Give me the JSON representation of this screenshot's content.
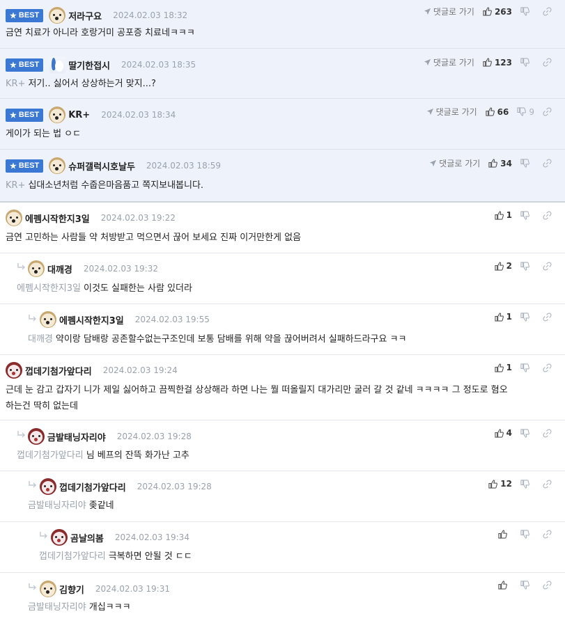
{
  "best_label": "BEST",
  "reply_label": "댓글로 가기",
  "comments": [
    {
      "id": "c1",
      "nickname": "저라구요",
      "date": "2024.02.03 18:32",
      "likes": "263",
      "dislikes": "",
      "target": "",
      "text": "금연 치료가 아니라 호랑거미 공포증 치료네ㅋㅋㅋ",
      "best": true,
      "avatar": "dog-icon"
    },
    {
      "id": "c2",
      "nickname": "딸기한접시",
      "date": "2024.02.03 18:35",
      "likes": "123",
      "dislikes": "",
      "target": "KR+",
      "text": "저기.. 싫어서 상상하는거 맞지...?",
      "best": true,
      "avatar": "bunny-icon"
    },
    {
      "id": "c3",
      "nickname": "KR+",
      "date": "2024.02.03 18:34",
      "likes": "66",
      "dislikes": "9",
      "target": "",
      "text": "게이가 되는 법 ㅇㄷ",
      "best": true,
      "avatar": "dog-icon"
    },
    {
      "id": "c4",
      "nickname": "슈퍼갤럭시호날두",
      "date": "2024.02.03 18:59",
      "likes": "34",
      "dislikes": "",
      "target": "KR+",
      "text": "십대소년처럼 수줍은마음품고 쪽지보내봅니다.",
      "best": true,
      "avatar": "dog-icon"
    },
    {
      "id": "c5",
      "nickname": "에펨시작한지3일",
      "date": "2024.02.03 19:22",
      "likes": "1",
      "dislikes": "",
      "target": "",
      "text": "금연 고민하는 사람들 약 처방받고 먹으면서 끊어 보세요 진짜 이거만한게 없음",
      "best": false,
      "avatar": "dog-icon"
    },
    {
      "id": "c6",
      "nickname": "대깨경",
      "date": "2024.02.03 19:32",
      "likes": "2",
      "dislikes": "",
      "target": "에펨시작한지3일",
      "text": "이것도 실패한는 사람 있더라",
      "best": false,
      "avatar": "dog-icon"
    },
    {
      "id": "c7",
      "nickname": "에펨시작한지3일",
      "date": "2024.02.03 19:55",
      "likes": "1",
      "dislikes": "",
      "target": "대깨경",
      "text": "약이랑 담배랑 공존할수없는구조인데 보통 담배를 위해 약을 끊어버려서 실패하드라구요 ㅋㅋ",
      "best": false,
      "avatar": "dog-icon"
    },
    {
      "id": "c8",
      "nickname": "껍데기첨가앞다리",
      "date": "2024.02.03 19:24",
      "likes": "1",
      "dislikes": "",
      "target": "",
      "text_line1": "근데 눈 감고 갑자기 니가 제일 싫어하고 끔찍한걸 상상해라 하면 나는 뭘 떠올릴지 대가리만 굴러 갈 것 같네 ㅋㅋㅋㅋ 그 정도로 혐오",
      "text_line2": "하는건 딱히 없는데",
      "best": false,
      "avatar": "red-icon"
    },
    {
      "id": "c9",
      "nickname": "금발태닝자리야",
      "date": "2024.02.03 19:28",
      "likes": "4",
      "dislikes": "",
      "target": "껍데기첨가앞다리",
      "text": "님 베프의 잔뜩 화가난 고추",
      "best": false,
      "avatar": "red-icon"
    },
    {
      "id": "c10",
      "nickname": "껍데기첨가앞다리",
      "date": "2024.02.03 19:28",
      "likes": "12",
      "dislikes": "",
      "target": "금발태닝자리야",
      "text": "좆같네",
      "best": false,
      "avatar": "red-icon"
    },
    {
      "id": "c11",
      "nickname": "곰날의봄",
      "date": "2024.02.03 19:34",
      "likes": "",
      "dislikes": "",
      "target": "껍데기첨가앞다리",
      "text": "극복하면 안될 것 ㄷㄷ",
      "best": false,
      "avatar": "red-icon"
    },
    {
      "id": "c12",
      "nickname": "김향기",
      "date": "2024.02.03 19:31",
      "likes": "",
      "dislikes": "",
      "target": "금발태닝자리야",
      "text": "개십ㅋㅋㅋ",
      "best": false,
      "avatar": "dog-icon"
    }
  ]
}
